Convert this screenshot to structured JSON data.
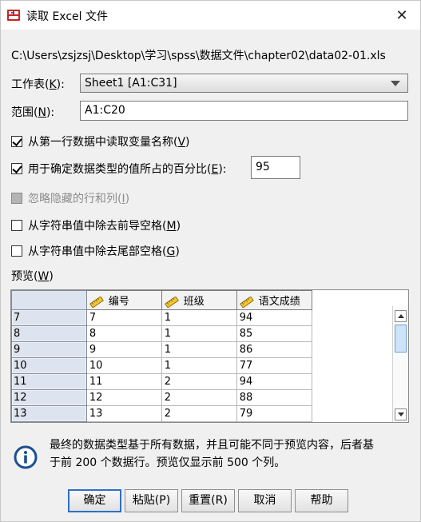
{
  "window": {
    "title": "读取 Excel 文件",
    "close_glyph": "✕"
  },
  "file_path": "C:\\Users\\zsjzsj\\Desktop\\学习\\spss\\数据文件\\chapter02\\data02-01.xls",
  "worksheet": {
    "label": "工作表",
    "accel": "K",
    "value": "Sheet1 [A1:C31]"
  },
  "range": {
    "label": "范围",
    "accel": "N",
    "value": "A1:C20"
  },
  "options": [
    {
      "label": "从第一行数据中读取变量名称",
      "accel": "V",
      "checked": true,
      "disabled": false
    },
    {
      "label": "用于确定数据类型的值所占的百分比",
      "accel": "E",
      "checked": true,
      "disabled": false,
      "field_value": "95"
    },
    {
      "label": "忽略隐藏的行和列",
      "accel": "I",
      "checked": false,
      "disabled": true
    },
    {
      "label": "从字符串值中除去前导空格",
      "accel": "M",
      "checked": false,
      "disabled": false
    },
    {
      "label": "从字符串值中除去尾部空格",
      "accel": "G",
      "checked": false,
      "disabled": false
    }
  ],
  "preview": {
    "label": "预览",
    "accel": "W",
    "columns": [
      "编号",
      "班级",
      "语文成绩"
    ],
    "column_icon": "ruler-icon",
    "rows": [
      {
        "num": "7",
        "cells": [
          "7",
          "1",
          "94"
        ]
      },
      {
        "num": "8",
        "cells": [
          "8",
          "1",
          "85"
        ]
      },
      {
        "num": "9",
        "cells": [
          "9",
          "1",
          "86"
        ]
      },
      {
        "num": "10",
        "cells": [
          "10",
          "1",
          "77"
        ]
      },
      {
        "num": "11",
        "cells": [
          "11",
          "2",
          "94"
        ]
      },
      {
        "num": "12",
        "cells": [
          "12",
          "2",
          "88"
        ]
      },
      {
        "num": "13",
        "cells": [
          "13",
          "2",
          "79"
        ]
      }
    ]
  },
  "info": {
    "icon": "info-icon",
    "line1": "最终的数据类型基于所有数据，并且可能不同于预览内容，后者基",
    "line2": "于前 200 个数据行。预览仅显示前 500 个列。"
  },
  "buttons": {
    "ok": "确定",
    "paste": "粘贴(P)",
    "reset": "重置(R)",
    "cancel": "取消",
    "help": "帮助"
  },
  "colors": {
    "accent": "#2f6fc7",
    "row_header_bg": "#dde4ef",
    "scroll_thumb": "#cfe3f8"
  }
}
